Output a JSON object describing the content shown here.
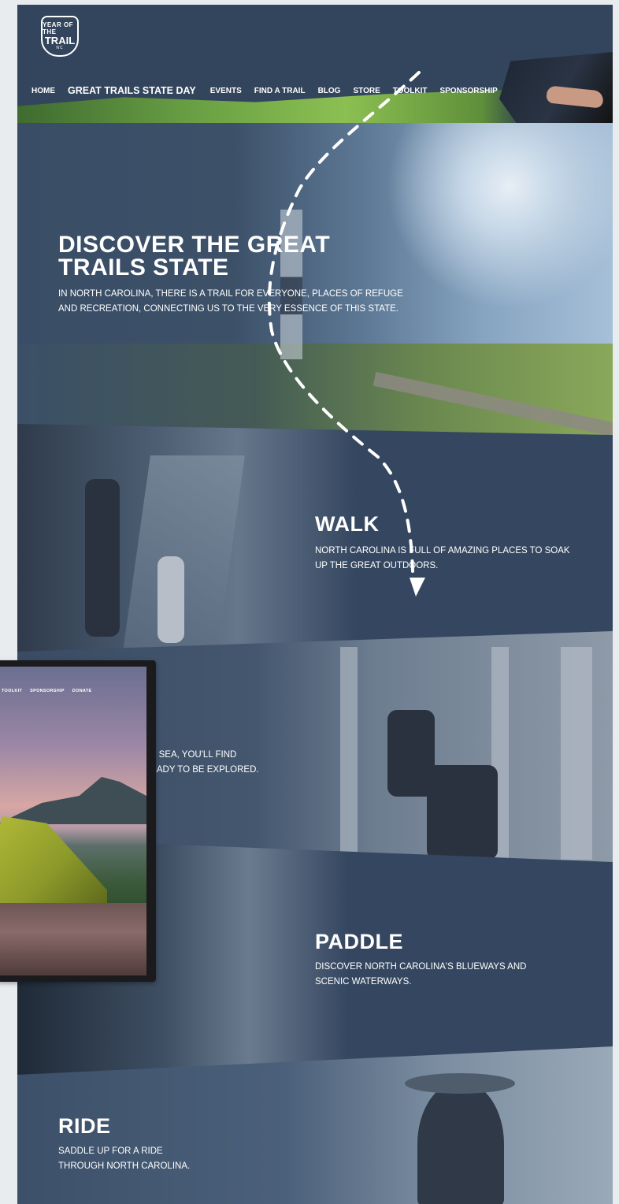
{
  "logo": {
    "line1": "YEAR OF THE",
    "line2": "TRAIL",
    "line3": "NC"
  },
  "nav": {
    "items": [
      {
        "label": "HOME",
        "big": false
      },
      {
        "label": "GREAT TRAILS STATE DAY",
        "big": true
      },
      {
        "label": "EVENTS",
        "big": false
      },
      {
        "label": "FIND A TRAIL",
        "big": false
      },
      {
        "label": "BLOG",
        "big": false
      },
      {
        "label": "STORE",
        "big": false
      },
      {
        "label": "TOOLKIT",
        "big": false
      },
      {
        "label": "SPONSORSHIP",
        "big": false
      }
    ]
  },
  "hero": {
    "title": "DISCOVER THE GREAT TRAILS STATE",
    "text": "IN NORTH CAROLINA, THERE IS A TRAIL FOR EVERYONE, PLACES OF REFUGE AND RECREATION, CONNECTING US TO THE VERY ESSENCE OF THIS STATE."
  },
  "walk": {
    "title": "WALK",
    "text": "NORTH CAROLINA IS FULL OF AMAZING PLACES TO SOAK UP THE GREAT OUTDOORS."
  },
  "bike": {
    "text_line1": "S TO SEA, YOU'LL FIND",
    "text_line2": "S READY TO BE EXPLORED."
  },
  "paddle": {
    "title": "PADDLE",
    "text": "DISCOVER NORTH CAROLINA'S BLUEWAYS AND SCENIC WATERWAYS."
  },
  "ride": {
    "title": "RIDE",
    "text": "SADDLE UP FOR A RIDE THROUGH NORTH CAROLINA."
  },
  "inset": {
    "nav": [
      "TOOLKIT",
      "SPONSORSHIP",
      "DONATE"
    ]
  },
  "colors": {
    "page_background": "#354760",
    "header": "#33455d",
    "text": "#ffffff",
    "outer_background": "#e9ecef"
  }
}
